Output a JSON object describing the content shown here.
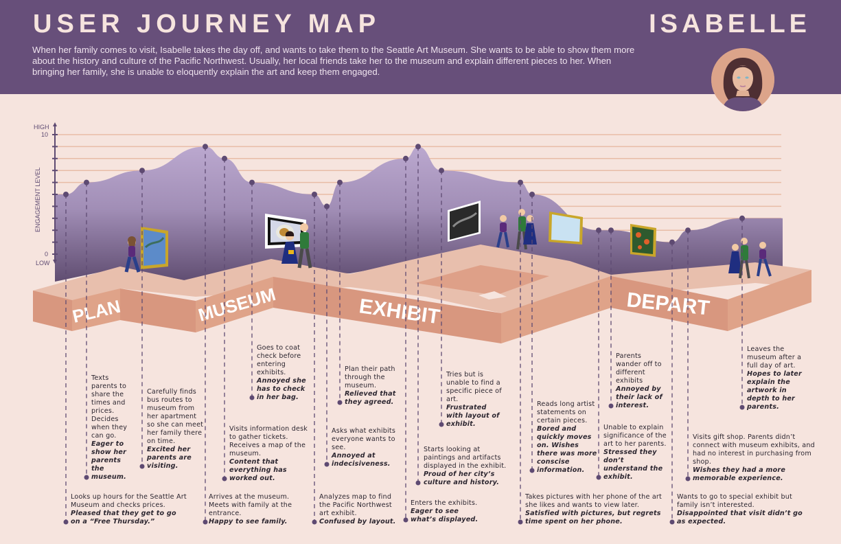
{
  "header": {
    "title": "USER JOURNEY MAP",
    "persona_name": "ISABELLE",
    "summary": "When her family comes to visit, Isabelle takes the day off, and wants to take them to the Seattle Art Museum. She wants to be able to show them more about the history and culture of the Pacific Northwest. Usually, her local friends take her to the museum and explain different pieces to her.  When bringing her family, she is unable to eloquently explain the art and keep them engaged.",
    "avatar_icon": "persona-portrait-icon"
  },
  "colors": {
    "header_bg": "#674f7a",
    "page_bg": "#f6e4de",
    "curve_top": "#bba8cf",
    "curve_bottom": "#5d4a6e",
    "gridline": "#e8bca6",
    "platform_top": "#e8bfad",
    "platform_side": "#d8977f",
    "point": "#5e4a72"
  },
  "stages": [
    "PLAN",
    "MUSEUM",
    "EXHIBIT",
    "DEPART"
  ],
  "chart_data": {
    "type": "line",
    "title": "",
    "ylabel": "ENGAGEMENT LEVEL",
    "y_high_label": "HIGH",
    "y_low_label": "LOW",
    "y_tick_labels": [
      "0",
      "10"
    ],
    "ylim": [
      0,
      10
    ],
    "grid": true,
    "series": [
      {
        "name": "Engagement",
        "values": [
          5,
          6,
          7,
          9,
          8,
          6,
          5,
          4,
          6,
          8,
          9,
          7,
          6,
          5,
          2,
          2,
          1,
          2,
          3
        ]
      }
    ]
  },
  "touchpoints": [
    {
      "stage": "PLAN",
      "action": "Looks up hours for the Seattle Art Museum and checks prices.",
      "emotion": "Pleased that they get to go on a “Free Thursday.”"
    },
    {
      "stage": "PLAN",
      "action": "Texts parents to share the times and prices. Decides when they can go.",
      "emotion": "Eager to show her parents the museum."
    },
    {
      "stage": "PLAN",
      "action": "Carefully finds bus routes to museum from her apartment so she can meet her family there on time.",
      "emotion": "Excited her parents are visiting."
    },
    {
      "stage": "MUSEUM",
      "action": "Arrives at the museum. Meets with family at the entrance.",
      "emotion": "Happy to see family."
    },
    {
      "stage": "MUSEUM",
      "action": "Visits information desk to gather tickets. Receives a map of the museum.",
      "emotion": "Content that everything has worked out."
    },
    {
      "stage": "MUSEUM",
      "action": "Goes to coat check before entering exhibits.",
      "emotion": "Annoyed she has to check in her bag."
    },
    {
      "stage": "MUSEUM",
      "action": "Analyzes map to find the Pacific Northwest art exhibit.",
      "emotion": "Confused by layout."
    },
    {
      "stage": "MUSEUM",
      "action": "Asks what exhibits everyone wants to see.",
      "emotion": "Annoyed at indecisiveness."
    },
    {
      "stage": "MUSEUM",
      "action": "Plan their path through the museum.",
      "emotion": "Relieved that they agreed."
    },
    {
      "stage": "EXHIBIT",
      "action": "Enters the exhibits.",
      "emotion": "Eager to see what’s displayed."
    },
    {
      "stage": "EXHIBIT",
      "action": "Starts looking at paintings and artifacts displayed in the exhibit.",
      "emotion": "Proud of her city’s culture and history."
    },
    {
      "stage": "EXHIBIT",
      "action": "Tries but is unable to find a specific piece of art.",
      "emotion": "Frustrated with layout of exhibit."
    },
    {
      "stage": "EXHIBIT",
      "action": "Takes pictures with her phone of the art she likes and wants to view later.",
      "emotion": "Satisfied with pictures, but regrets time spent on her phone."
    },
    {
      "stage": "EXHIBIT",
      "action": "Reads long artist statements on certain pieces.",
      "emotion": "Bored and quickly moves on. Wishes there was more conscise information."
    },
    {
      "stage": "EXHIBIT",
      "action": "Unable to explain significance of the art to her parents.",
      "emotion": "Stressed they don’t understand the exhibit."
    },
    {
      "stage": "EXHIBIT",
      "action": "Parents wander off to different exhibits",
      "emotion": "Annoyed by their lack of interest."
    },
    {
      "stage": "DEPART",
      "action": "Wants to go to special exhibit but family isn’t interested.",
      "emotion": "Disappointed that visit didn’t go as expected."
    },
    {
      "stage": "DEPART",
      "action": "Visits gift shop. Parents didn’t connect with museum exhibits, and had no interest in purchasing from shop.",
      "emotion": "Wishes they had a more memorable experience."
    },
    {
      "stage": "DEPART",
      "action": "Leaves the museum after a full day of art.",
      "emotion": "Hopes to later explain the artwork in depth to her parents."
    }
  ]
}
